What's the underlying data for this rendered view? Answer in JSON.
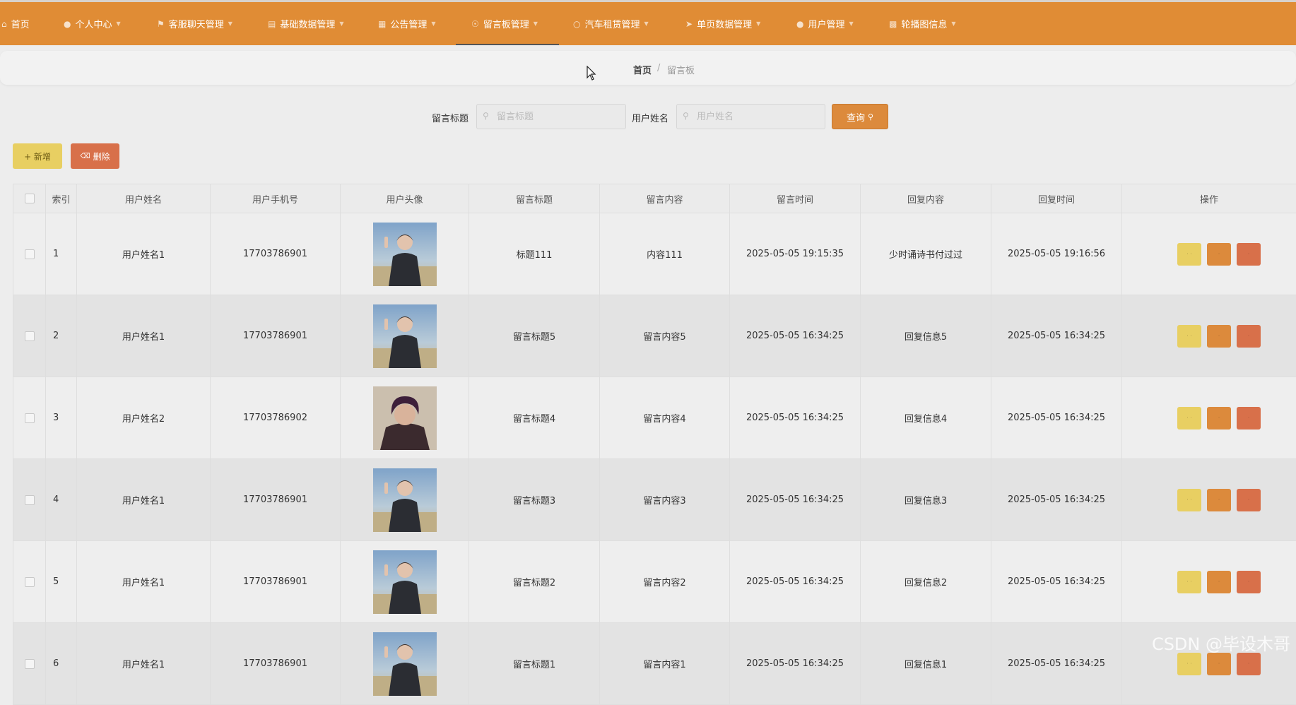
{
  "nav": {
    "items": [
      {
        "label": "首页",
        "icon": "home-icon"
      },
      {
        "label": "个人中心",
        "icon": "user-icon"
      },
      {
        "label": "客服聊天管理",
        "icon": "flag-icon"
      },
      {
        "label": "基础数据管理",
        "icon": "stack-icon"
      },
      {
        "label": "公告管理",
        "icon": "grid-icon"
      },
      {
        "label": "留言板管理",
        "icon": "compass-icon"
      },
      {
        "label": "汽车租赁管理",
        "icon": "circle-icon"
      },
      {
        "label": "单页数据管理",
        "icon": "send-icon"
      },
      {
        "label": "用户管理",
        "icon": "person-icon"
      },
      {
        "label": "轮播图信息",
        "icon": "bar-chart-icon"
      }
    ],
    "active_index": 5
  },
  "breadcrumb": {
    "home": "首页",
    "separator": "/",
    "current": "留言板"
  },
  "search": {
    "title_label": "留言标题",
    "title_placeholder": "留言标题",
    "username_label": "用户姓名",
    "username_placeholder": "用户姓名",
    "button_label": "查询",
    "button_icon": "search-icon"
  },
  "actions": {
    "add_label": "+ 新增",
    "delete_label": "删除",
    "delete_icon": "trash-icon"
  },
  "table": {
    "headers": [
      "索引",
      "用户姓名",
      "用户手机号",
      "用户头像",
      "留言标题",
      "留言内容",
      "留言时间",
      "回复内容",
      "回复时间",
      "操作"
    ],
    "rows": [
      {
        "index": "1",
        "username": "用户姓名1",
        "phone": "17703786901",
        "avatar": "photo-a",
        "title": "标题111",
        "content": "内容111",
        "msg_time": "2025-05-05 19:15:35",
        "reply": "少时诵诗书付过过",
        "reply_time": "2025-05-05 19:16:56"
      },
      {
        "index": "2",
        "username": "用户姓名1",
        "phone": "17703786901",
        "avatar": "photo-a",
        "title": "留言标题5",
        "content": "留言内容5",
        "msg_time": "2025-05-05 16:34:25",
        "reply": "回复信息5",
        "reply_time": "2025-05-05 16:34:25"
      },
      {
        "index": "3",
        "username": "用户姓名2",
        "phone": "17703786902",
        "avatar": "photo-b",
        "title": "留言标题4",
        "content": "留言内容4",
        "msg_time": "2025-05-05 16:34:25",
        "reply": "回复信息4",
        "reply_time": "2025-05-05 16:34:25"
      },
      {
        "index": "4",
        "username": "用户姓名1",
        "phone": "17703786901",
        "avatar": "photo-a",
        "title": "留言标题3",
        "content": "留言内容3",
        "msg_time": "2025-05-05 16:34:25",
        "reply": "回复信息3",
        "reply_time": "2025-05-05 16:34:25"
      },
      {
        "index": "5",
        "username": "用户姓名1",
        "phone": "17703786901",
        "avatar": "photo-a",
        "title": "留言标题2",
        "content": "留言内容2",
        "msg_time": "2025-05-05 16:34:25",
        "reply": "回复信息2",
        "reply_time": "2025-05-05 16:34:25"
      },
      {
        "index": "6",
        "username": "用户姓名1",
        "phone": "17703786901",
        "avatar": "photo-a",
        "title": "留言标题1",
        "content": "留言内容1",
        "msg_time": "2025-05-05 16:34:25",
        "reply": "回复信息1",
        "reply_time": "2025-05-05 16:34:25"
      }
    ]
  },
  "watermark": "CSDN @毕设木哥",
  "colors": {
    "nav_bg": "#e08c35",
    "search_button": "#dc8a3c",
    "add_button": "#e8cf62",
    "delete_button": "#d8704a",
    "row_action_yellow": "#e8cf62",
    "row_action_orange": "#dc8a3c",
    "row_action_red": "#d8704a"
  }
}
